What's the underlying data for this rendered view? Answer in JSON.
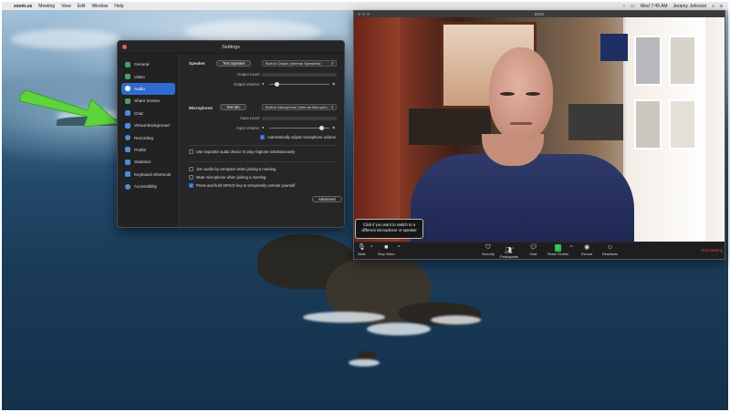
{
  "menubar": {
    "apple": "",
    "app_name": "zoom.us",
    "items": [
      "Meeting",
      "View",
      "Edit",
      "Window",
      "Help"
    ],
    "clock": "Wed 7:49 AM",
    "user": "Jeramy Johnson"
  },
  "settings": {
    "title": "Settings",
    "sidebar": [
      {
        "label": "General",
        "color": "#3fa46a"
      },
      {
        "label": "Video",
        "color": "#3fa46a"
      },
      {
        "label": "Audio",
        "color": "#ffffff"
      },
      {
        "label": "Share Screen",
        "color": "#3fa46a"
      },
      {
        "label": "Chat",
        "color": "#4a8fe0"
      },
      {
        "label": "Virtual Background",
        "color": "#4a8fe0"
      },
      {
        "label": "Recording",
        "color": "#4a8fe0"
      },
      {
        "label": "Profile",
        "color": "#4a8fe0"
      },
      {
        "label": "Statistics",
        "color": "#4a8fe0"
      },
      {
        "label": "Keyboard Shortcuts",
        "color": "#4a8fe0"
      },
      {
        "label": "Accessibility",
        "color": "#4a8fe0"
      }
    ],
    "active_item": "Audio",
    "speaker": {
      "label": "Speaker",
      "test_button": "Test Speaker",
      "device": "Built-in Output (Internal Speakers)",
      "output_level_label": "Output Level:",
      "output_volume_label": "Output Volume:",
      "output_volume": 0.1
    },
    "microphone": {
      "label": "Microphone",
      "test_button": "Test Mic",
      "device": "Built-in Microphone (Internal Micropho...",
      "input_level_label": "Input Level:",
      "input_volume_label": "Input Volume:",
      "input_volume": 0.9,
      "auto_adjust": "Automatically adjust microphone volume"
    },
    "options": [
      {
        "label": "Use separate audio device to play ringtone simultaneously",
        "checked": false
      },
      {
        "label": "Join audio by computer when joining a meeting",
        "checked": false
      },
      {
        "label": "Mute microphone when joining a meeting",
        "checked": false
      },
      {
        "label": "Press and hold SPACE key to temporarily unmute yourself",
        "checked": true
      }
    ],
    "advanced_button": "Advanced"
  },
  "zoom": {
    "title": "Zoom",
    "tooltip": "Click if you want to switch to a different microphone or speaker",
    "toolbar": [
      {
        "label": "Mute",
        "icon": "microphone-icon"
      },
      {
        "label": "Stop Video",
        "icon": "video-camera-icon"
      },
      {
        "label": "Security",
        "icon": "shield-icon"
      },
      {
        "label": "Participants",
        "icon": "participants-icon"
      },
      {
        "label": "Chat",
        "icon": "chat-icon"
      },
      {
        "label": "Share Screen",
        "icon": "share-screen-icon"
      },
      {
        "label": "Record",
        "icon": "record-icon"
      },
      {
        "label": "Reactions",
        "icon": "smiley-icon"
      }
    ],
    "participants_count": "1",
    "end_button": "End Meeting"
  }
}
